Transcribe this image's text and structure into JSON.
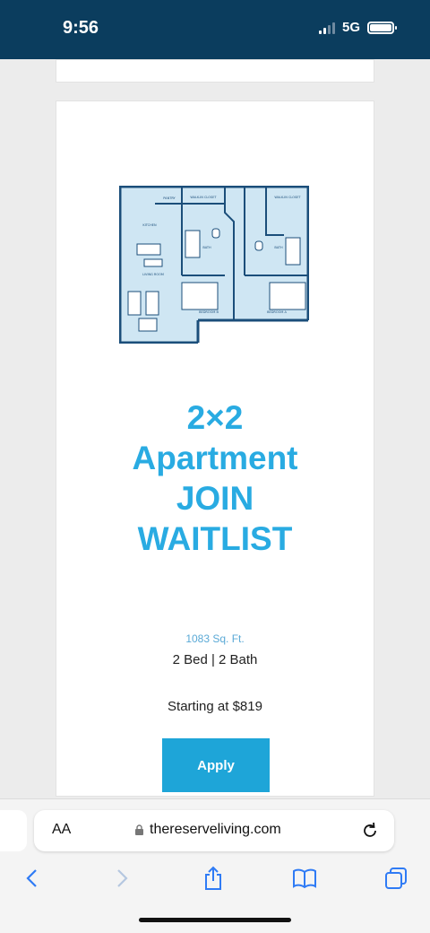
{
  "status": {
    "time": "9:56",
    "network": "5G"
  },
  "listing": {
    "title_lines": [
      "2×2",
      "Apartment",
      "JOIN",
      "WAITLIST"
    ],
    "sqft": "1083 Sq. Ft.",
    "bed_bath": "2 Bed | 2 Bath",
    "price": "Starting at $819",
    "apply_label": "Apply"
  },
  "floorplan_labels": {
    "pantry": "PANTRY",
    "walkin1": "WALK-IN CLOSET",
    "walkin2": "WALK-IN CLOSET",
    "kitchen": "KITCHEN",
    "living": "LIVING ROOM",
    "bath1": "BATH",
    "bath2": "BATH",
    "bedroom_b": "BEDROOM B",
    "bedroom_a": "BEDROOM A"
  },
  "browser": {
    "aa_label": "AA",
    "url": "thereserveliving.com"
  },
  "colors": {
    "accent": "#29abe2",
    "status_bar": "#0b3d5e",
    "button": "#1ea5d8",
    "floorplan_fill": "#cfe6f3",
    "floorplan_wall": "#1b4e7a"
  },
  "icons": [
    "lock-icon",
    "reload-icon",
    "back-icon",
    "forward-icon",
    "share-icon",
    "bookmarks-icon",
    "tabs-icon"
  ]
}
